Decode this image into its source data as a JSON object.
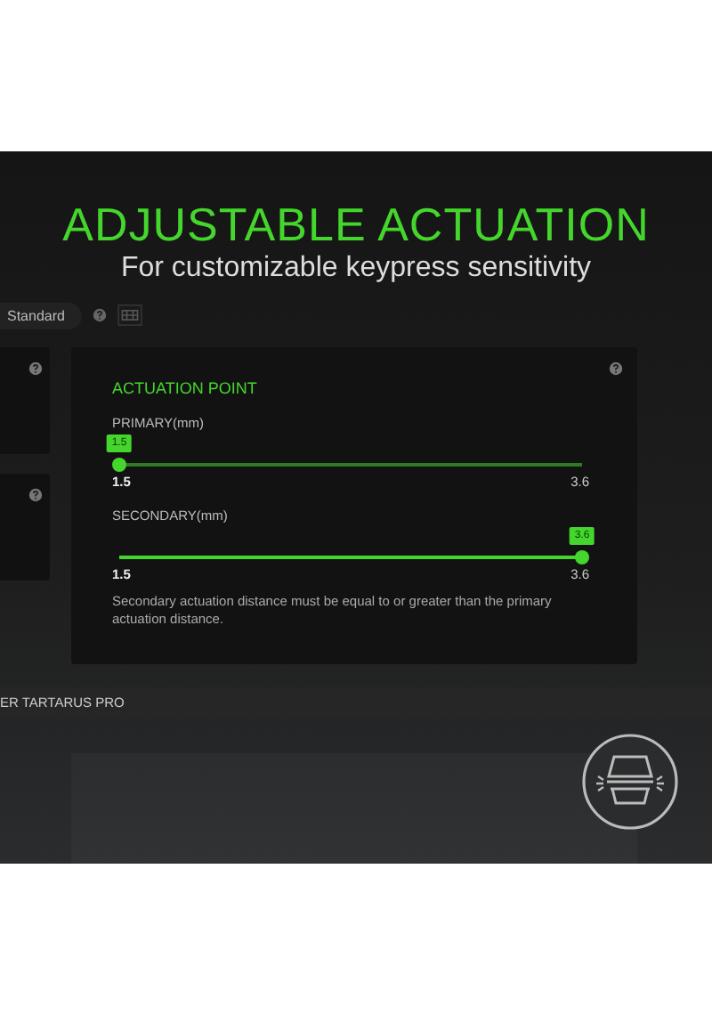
{
  "hero": {
    "title": "ADJUSTABLE ACTUATION",
    "subtitle": "For customizable keypress sensitivity"
  },
  "toolbar": {
    "mode": "Standard"
  },
  "panel": {
    "title": "ACTUATION POINT",
    "sliders": [
      {
        "label": "PRIMARY(mm)",
        "value": "1.5",
        "level": 0,
        "min": "1.5",
        "max": "3.6"
      },
      {
        "label": "SECONDARY(mm)",
        "value": "3.6",
        "level": 1,
        "min": "1.5",
        "max": "3.6"
      }
    ],
    "note": "Secondary actuation distance must be equal to or greater than the primary actuation distance."
  },
  "device_bar": {
    "name": "ER TARTARUS PRO"
  }
}
